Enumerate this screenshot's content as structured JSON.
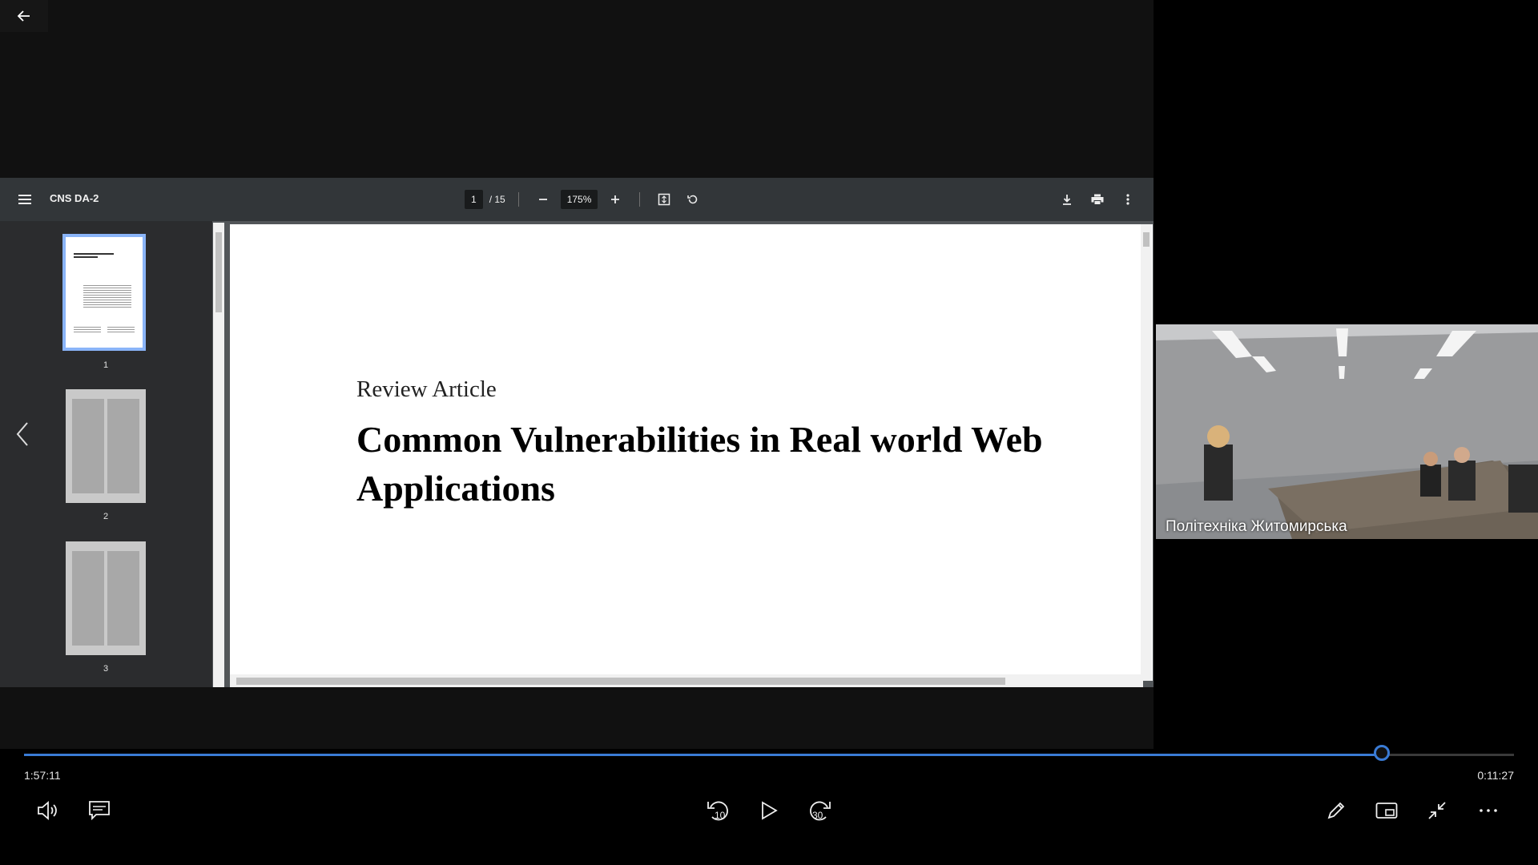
{
  "pdf": {
    "doc_title": "CNS DA-2",
    "current_page": "1",
    "page_total": "/ 15",
    "zoom": "175%",
    "thumbnails": [
      {
        "label": "1"
      },
      {
        "label": "2"
      },
      {
        "label": "3"
      }
    ]
  },
  "page_content": {
    "kicker": "Review Article",
    "title": "Common Vulnerabilities in Real world Web Applications"
  },
  "camera": {
    "name": "Політехніка Житомирська"
  },
  "player": {
    "elapsed": "1:57:11",
    "remaining": "0:11:27",
    "progress": 0.9114,
    "accent": "#3a7bd5"
  }
}
